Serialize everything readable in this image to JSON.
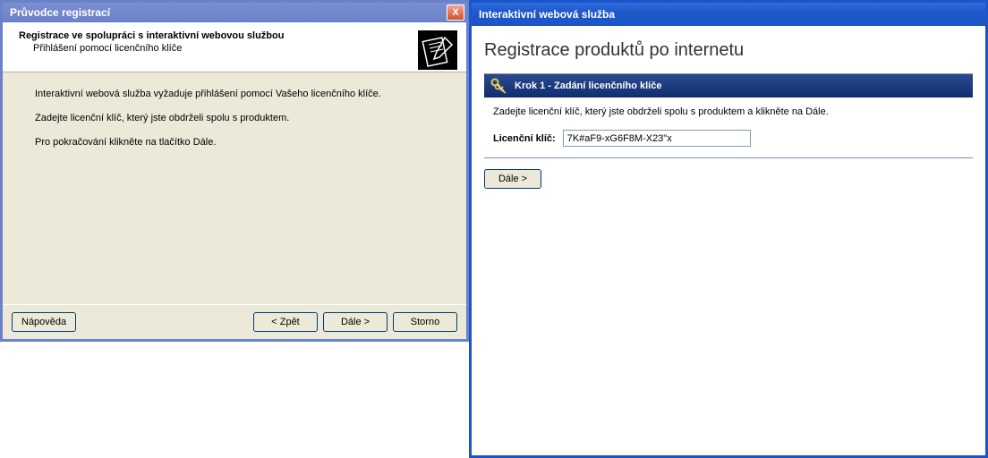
{
  "leftWindow": {
    "title": "Průvodce registrací",
    "closeLabel": "X",
    "header": {
      "title": "Registrace ve spolupráci s interaktivní webovou službou",
      "subtitle": "Přihlášení pomocí licenčního klíče"
    },
    "body": {
      "line1": "Interaktivní webová služba vyžaduje přihlášení pomocí Vašeho licenčního klíče.",
      "line2": "Zadejte licenční klíč, který jste obdrželi spolu s produktem.",
      "line3": "Pro pokračování klikněte na tlačítko Dále."
    },
    "buttons": {
      "help": "Nápověda",
      "back": "< Zpět",
      "next": "Dále >",
      "cancel": "Storno"
    }
  },
  "rightWindow": {
    "title": "Interaktivní webová služba",
    "heading": "Registrace produktů po internetu",
    "panel": {
      "stepTitle": "Krok 1 - Zadání licenčního klíče",
      "instruction": "Zadejte licenční klíč, který jste obdrželi spolu s produktem a klikněte na Dále.",
      "fieldLabel": "Licenční klíč:",
      "fieldValue": "7K#aF9-xG6F8M-X23\"x"
    },
    "buttons": {
      "next": "Dále >"
    }
  }
}
